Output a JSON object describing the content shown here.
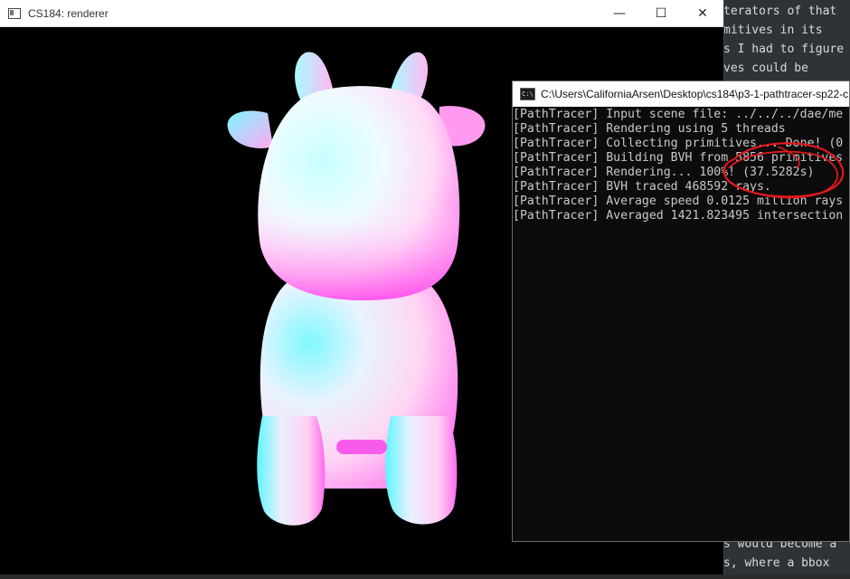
{
  "background_editor": {
    "lines": [
      "terators of that",
      "mitives in its",
      "s I had to figure",
      "ves could be",
      "s would become a",
      "s, where a bbox"
    ]
  },
  "renderer_window": {
    "title": "CS184: renderer",
    "controls": {
      "minimize": "—",
      "maximize": "☐",
      "close": "✕"
    }
  },
  "console_window": {
    "title": "C:\\Users\\CaliforniaArsen\\Desktop\\cs184\\p3-1-pathtracer-sp22-c",
    "icon_text": "C:\\",
    "lines": [
      "[PathTracer] Input scene file: ../../../dae/me",
      "[PathTracer] Rendering using 5 threads",
      "[PathTracer] Collecting primitives... Done! (0",
      "[PathTracer] Building BVH from 5856 primitives",
      "[PathTracer] Rendering... 100%! (37.5282s)",
      "[PathTracer] BVH traced 468592 rays.",
      "[PathTracer] Average speed 0.0125 million rays",
      "[PathTracer] Averaged 1421.823495 intersection"
    ]
  },
  "colors": {
    "cow_cyan": "#6ff7ff",
    "cow_magenta": "#ff5cf3",
    "cow_white": "#fff3fb",
    "annotation_red": "#e0191c"
  }
}
